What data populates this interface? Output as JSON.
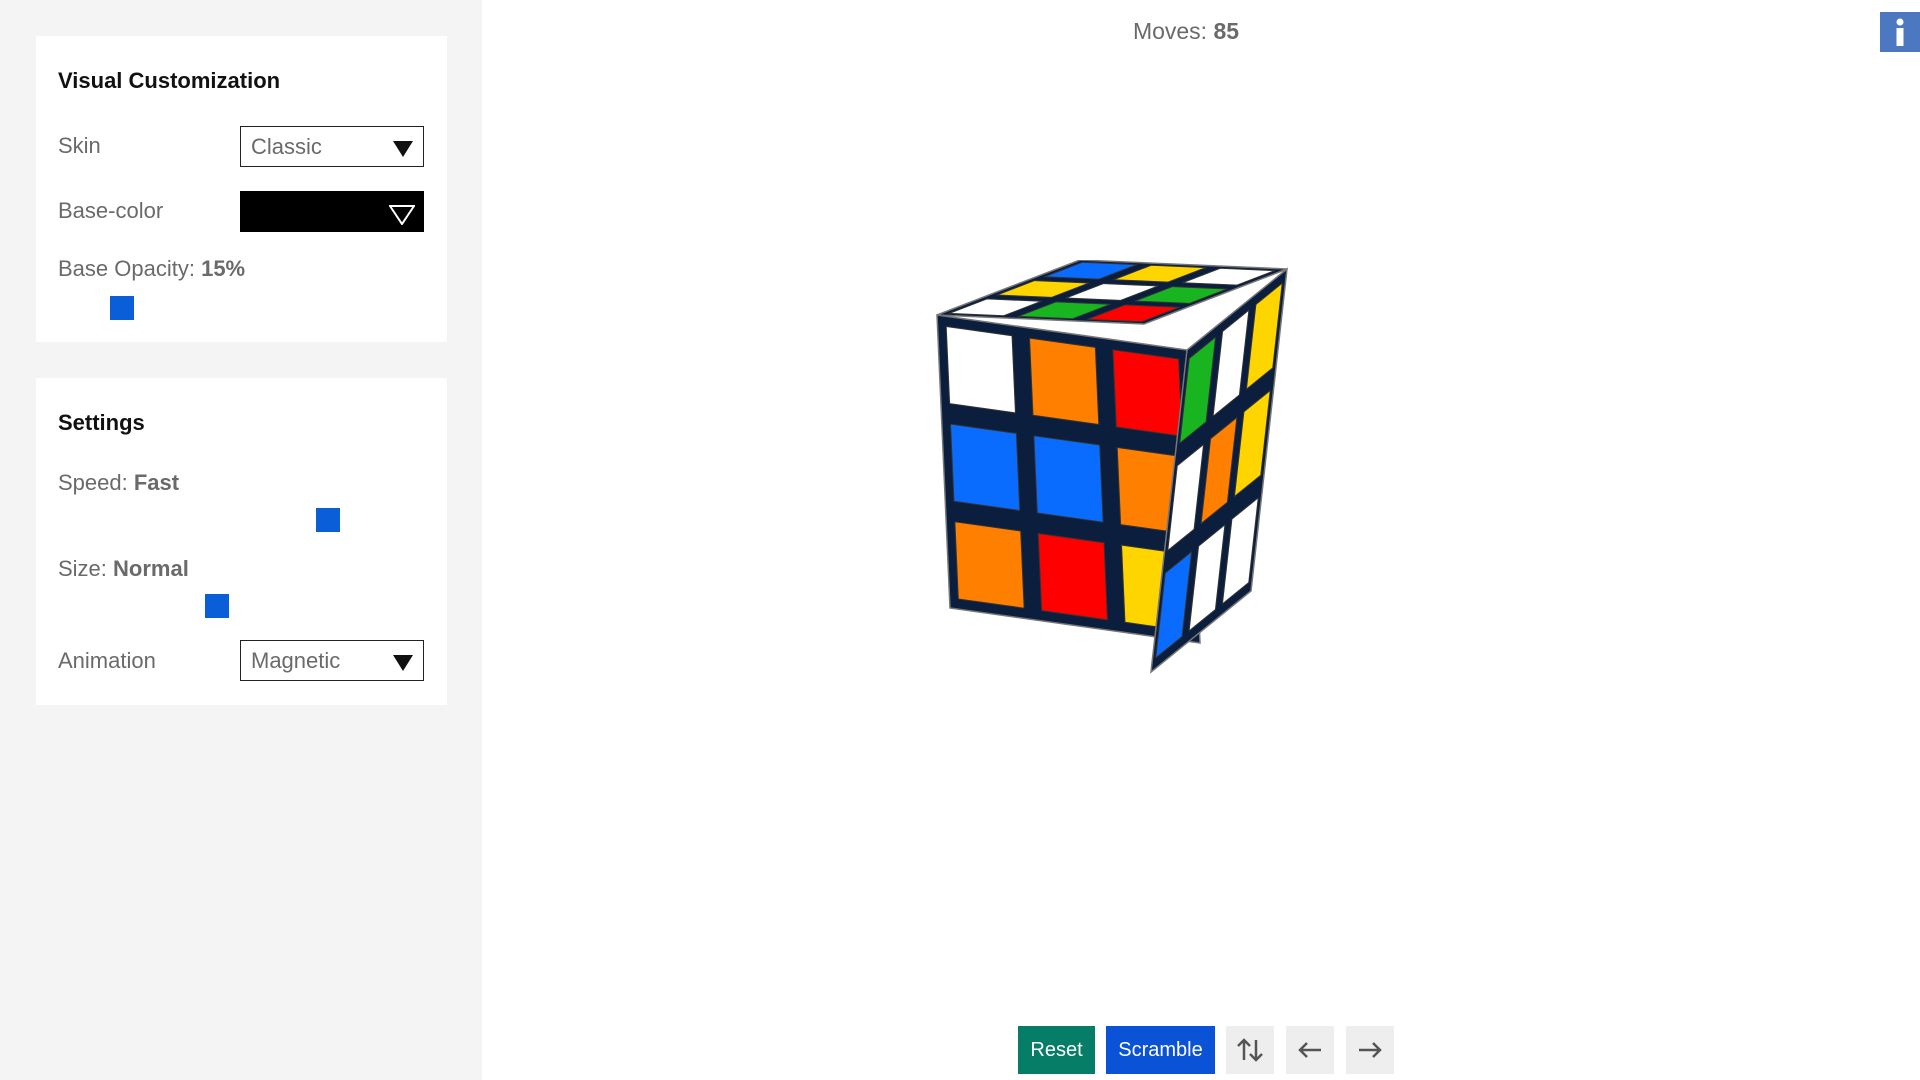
{
  "sidebar": {
    "visual": {
      "title": "Visual Customization",
      "skin_label": "Skin",
      "skin_value": "Classic",
      "base_color_label": "Base-color",
      "base_color_value": "#000000",
      "opacity_label": "Base Opacity:",
      "opacity_value": "15%",
      "opacity_fraction": 0.15
    },
    "settings": {
      "title": "Settings",
      "speed_label": "Speed:",
      "speed_value": "Fast",
      "size_label": "Size:",
      "size_value": "Normal",
      "animation_label": "Animation",
      "animation_value": "Magnetic"
    }
  },
  "header": {
    "moves_label": "Moves:",
    "moves_value": "85",
    "info_icon": "info-icon"
  },
  "cube": {
    "colors": {
      "white": "#ffffff",
      "yellow": "#ffd500",
      "red": "#ff0000",
      "orange": "#ff8000",
      "blue": "#0a6cff",
      "green": "#19b521"
    },
    "top_face": [
      [
        "blue",
        "yellow",
        "white"
      ],
      [
        "yellow",
        "white",
        "green"
      ],
      [
        "white",
        "green",
        "red"
      ]
    ],
    "front_face": [
      [
        "white",
        "orange",
        "red"
      ],
      [
        "blue",
        "blue",
        "orange"
      ],
      [
        "orange",
        "red",
        "yellow"
      ]
    ],
    "right_face": [
      [
        "green",
        "white",
        "yellow"
      ],
      [
        "white",
        "orange",
        "yellow"
      ],
      [
        "blue",
        "white",
        "white"
      ]
    ]
  },
  "toolbar": {
    "reset_label": "Reset",
    "scramble_label": "Scramble",
    "flip_icon": "swap-vertical-icon",
    "undo_icon": "arrow-left-icon",
    "redo_icon": "arrow-right-icon"
  },
  "theme": {
    "accent_blue": "#0a52d6",
    "reset_green": "#057d67",
    "info_blue": "#4b78c0",
    "sidebar_bg": "#f4f4f4"
  }
}
